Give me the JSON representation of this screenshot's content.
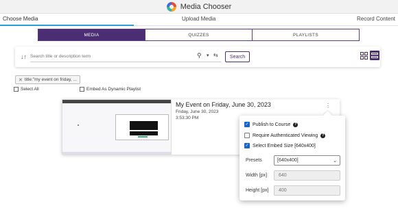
{
  "app": {
    "title": "Media Chooser"
  },
  "top_tabs": {
    "choose": "Choose Media",
    "upload": "Upload Media",
    "record": "Record Content"
  },
  "segment_tabs": [
    "MEDIA",
    "QUIZZES",
    "PLAYLISTS"
  ],
  "search": {
    "placeholder": "Search title or description term",
    "button": "Search"
  },
  "filter_chip": {
    "label": "title:\"my event on friday, ..."
  },
  "select_all": {
    "label": "Select All"
  },
  "embed_playlist": {
    "label": "Embed As Dynamic Playlist"
  },
  "media": {
    "title": "My Event on Friday, June 30, 2023",
    "date": "Friday, June 30, 2023",
    "time": "3:53:30 PM"
  },
  "popover": {
    "publish": {
      "label": "Publish to Course",
      "checked": true
    },
    "require_auth": {
      "label": "Require Authenticated Viewing",
      "checked": false
    },
    "embed_size": {
      "label": "Select Embed Size [640x400]",
      "checked": true
    },
    "presets": {
      "label": "Presets",
      "value": "[640x400]"
    },
    "width": {
      "label": "Width [px]",
      "value": "640"
    },
    "height": {
      "label": "Height [px]",
      "value": "400"
    }
  },
  "colors": {
    "accent": "#4a2d73",
    "tab_underline": "#2a9fd6",
    "checkbox": "#1a63c9"
  }
}
